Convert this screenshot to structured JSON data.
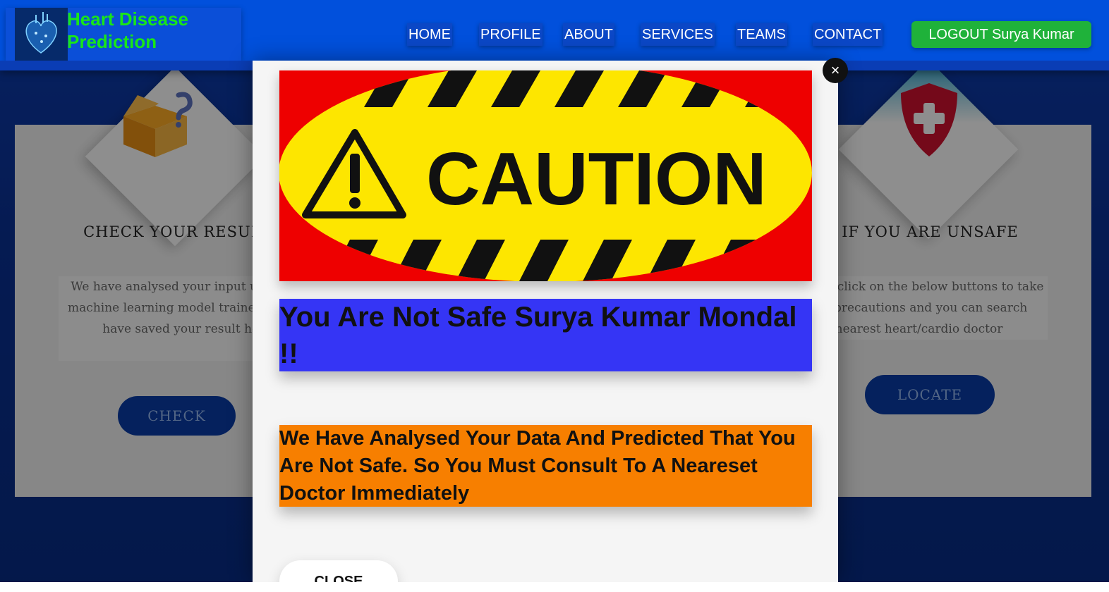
{
  "brand": {
    "name": "Heart Disease Prediction",
    "logo_icon": "heart-anatomy-icon"
  },
  "nav": {
    "items": [
      {
        "label": "HOME"
      },
      {
        "label": "PROFILE"
      },
      {
        "label": "ABOUT"
      },
      {
        "label": "SERVICES"
      },
      {
        "label": "TEAMS"
      },
      {
        "label": "CONTACT"
      }
    ],
    "logout_label": "LOGOUT Surya Kumar"
  },
  "cards": {
    "left": {
      "title": "CHECK YOUR RESULT",
      "text": "We have analysed your input using our machine learning model trained and we have saved your result here.",
      "button": "CHECK",
      "icon": "open-box-question-icon"
    },
    "right": {
      "title": "IF YOU ARE UNSAFE",
      "text": "Please click on the below buttons to take the precautions and you can search nearest heart/cardio doctor",
      "button": "LOCATE",
      "icon": "medical-shield-icon"
    }
  },
  "modal": {
    "banner_text": "CAUTION",
    "banner_icon": "warning-triangle-icon",
    "title": "You Are Not Safe Surya Kumar Mondal !!",
    "message": "We Have Analysed Your Data And Predicted That You Are Not Safe. So You Must Consult To A Neareset Doctor Immediately",
    "close_label": "CLOSE",
    "close_x": "×"
  },
  "colors": {
    "navbar": "#0150dc",
    "brand_text": "#19e619",
    "logout": "#1fb23a",
    "title_box": "#3535f5",
    "message_box": "#f77f00",
    "banner_red": "#ee0000",
    "banner_yellow": "#fde600"
  }
}
